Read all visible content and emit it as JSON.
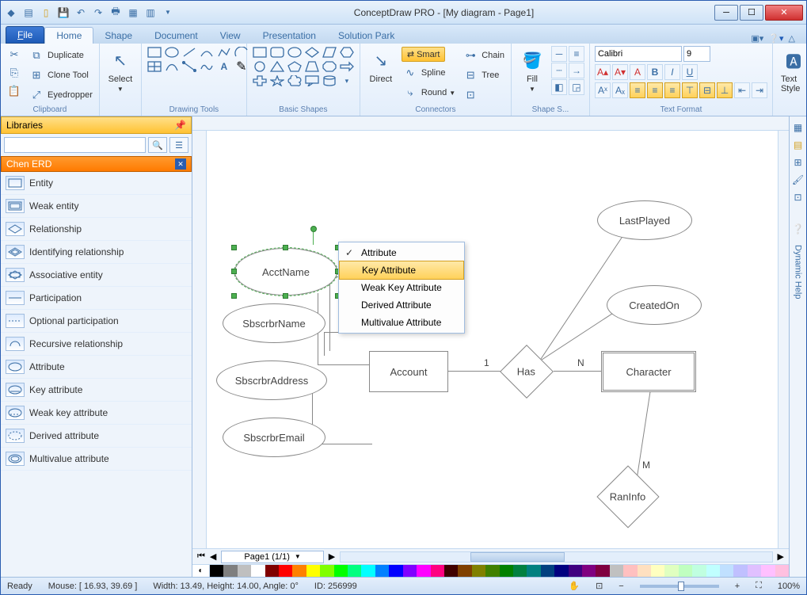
{
  "title": "ConceptDraw PRO  -  [My diagram - Page1]",
  "tabs": {
    "file": "File",
    "items": [
      "Home",
      "Shape",
      "Document",
      "View",
      "Presentation",
      "Solution Park"
    ],
    "active": "Home"
  },
  "ribbon": {
    "clipboard": {
      "label": "Clipboard",
      "duplicate": "Duplicate",
      "clone": "Clone Tool",
      "eyedropper": "Eyedropper"
    },
    "select": {
      "label": "Select"
    },
    "drawing": {
      "label": "Drawing Tools"
    },
    "shapes": {
      "label": "Basic Shapes"
    },
    "direct": {
      "label": "Direct"
    },
    "connectors": {
      "label": "Connectors",
      "smart": "Smart",
      "spline": "Spline",
      "round": "Round",
      "chain": "Chain",
      "tree": "Tree"
    },
    "fill": {
      "label": "Fill"
    },
    "shapestyle": {
      "label": "Shape S..."
    },
    "font": {
      "name": "Calibri",
      "size": "9"
    },
    "textformat": {
      "label": "Text Format"
    },
    "textstyle": {
      "label": "Text Style"
    }
  },
  "libraries": {
    "header": "Libraries",
    "category": "Chen ERD",
    "items": [
      "Entity",
      "Weak entity",
      "Relationship",
      "Identifying relationship",
      "Associative entity",
      "Participation",
      "Optional participation",
      "Recursive relationship",
      "Attribute",
      "Key attribute",
      "Weak key attribute",
      "Derived attribute",
      "Multivalue attribute"
    ]
  },
  "canvas": {
    "shapes": {
      "acctname": "AcctName",
      "sbscrbrname": "SbscrbrName",
      "sbscrbraddress": "SbscrbrAddress",
      "sbscrbremail": "SbscrbrEmail",
      "account": "Account",
      "has": "Has",
      "character": "Character",
      "lastplayed": "LastPlayed",
      "createdon": "CreatedOn",
      "raninfo": "RanInfo"
    },
    "card": {
      "one": "1",
      "n": "N",
      "m": "M"
    }
  },
  "contextmenu": {
    "items": [
      "Attribute",
      "Key Attribute",
      "Weak Key Attribute",
      "Derived Attribute",
      "Multivalue Attribute"
    ],
    "checked": 0,
    "highlighted": 1
  },
  "page_tab": "Page1 (1/1)",
  "rsidebar": {
    "help": "Dynamic Help"
  },
  "status": {
    "ready": "Ready",
    "mouse": "Mouse: [ 16.93, 39.69 ]",
    "dims": "Width: 13.49,  Height: 14.00,  Angle: 0°",
    "id": "ID: 256999",
    "zoom": "100%"
  },
  "colors": [
    "#000",
    "#7f7f7f",
    "#bfbfbf",
    "#fff",
    "#800000",
    "#f00",
    "#ff8000",
    "#ff0",
    "#80ff00",
    "#0f0",
    "#00ff80",
    "#0ff",
    "#0080ff",
    "#00f",
    "#8000ff",
    "#f0f",
    "#ff0080",
    "#400000",
    "#804000",
    "#808000",
    "#408000",
    "#008000",
    "#008040",
    "#008080",
    "#004080",
    "#000080",
    "#400080",
    "#800080",
    "#800040",
    "#c0c0c0",
    "#ffc0c0",
    "#ffe0c0",
    "#ffffc0",
    "#e0ffc0",
    "#c0ffc0",
    "#c0ffe0",
    "#c0ffff",
    "#c0e0ff",
    "#c0c0ff",
    "#e0c0ff",
    "#ffc0ff",
    "#ffc0e0"
  ]
}
